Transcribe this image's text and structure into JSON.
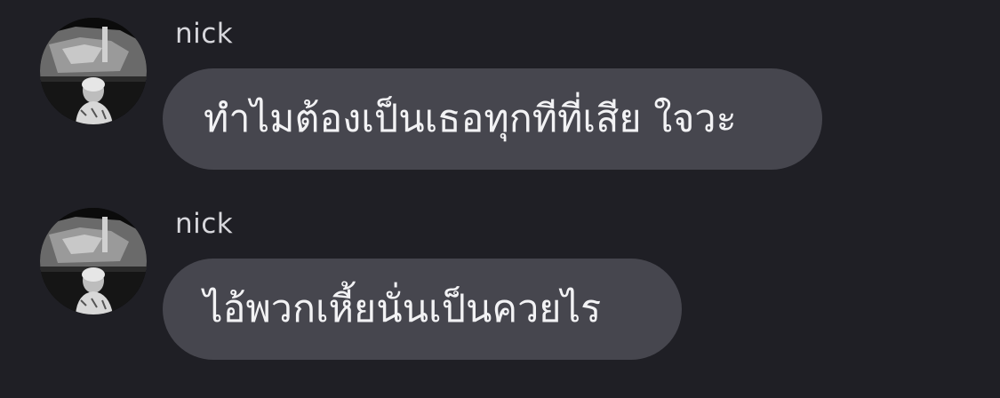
{
  "messages": [
    {
      "sender": "nick",
      "avatar_icon": "profile-photo-avatar",
      "text": "ทำไมต้องเป็นเธอทุกทีที่เสีย ใจวะ"
    },
    {
      "sender": "nick",
      "avatar_icon": "profile-photo-avatar",
      "text": "ไอ้พวกเหี้ยนั่นเป็นควยไร"
    }
  ],
  "colors": {
    "background": "#1f1f25",
    "bubble": "#46464e",
    "bubble_text": "#f2f2f4",
    "sender_text": "#d7d7dc"
  }
}
